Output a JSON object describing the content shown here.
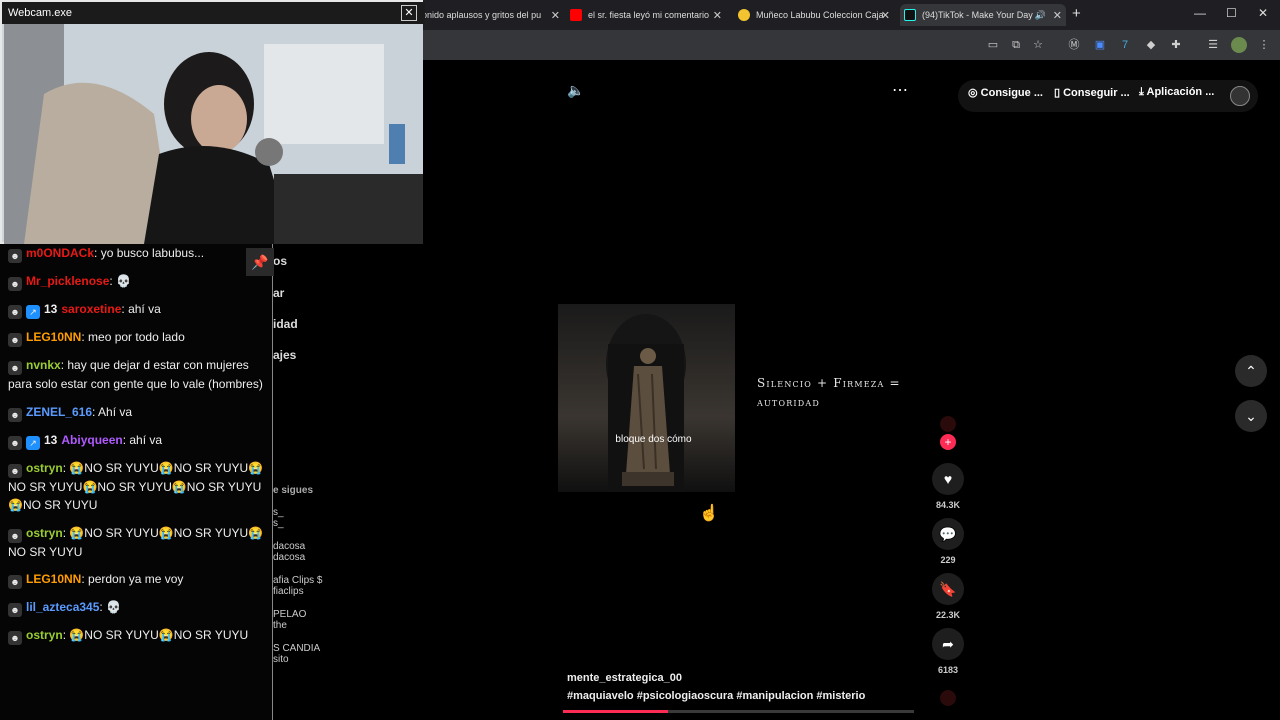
{
  "browser": {
    "tabs": [
      {
        "label": "onido aplausos y gritos del pu",
        "favicon_color": "#ff0000"
      },
      {
        "label": "el sr. fiesta leyó mi comentario",
        "favicon_color": "#ff0000"
      },
      {
        "label": "Muñeco Labubu Coleccion Caja",
        "favicon_color": "#f4c430"
      },
      {
        "label": "(94)TikTok - Make Your Day",
        "favicon_color": "#25f4ee"
      }
    ],
    "new_tab": "+",
    "close": "✕",
    "window_controls": [
      "—",
      "☐",
      "✕"
    ]
  },
  "webcam": {
    "title": "Webcam.exe",
    "close": "✕"
  },
  "chat": {
    "pin_icon": "pin-icon",
    "messages": [
      {
        "user": "m0ONDACk",
        "color": "#e91916",
        "text": "yo busco labubus..."
      },
      {
        "user": "Mr_picklenose",
        "color": "#e91916",
        "text": "💀"
      },
      {
        "badge_num": "13",
        "user": "saroxetine",
        "color": "#e91916",
        "text": "ahí va"
      },
      {
        "user": "LEG10NN",
        "color": "#ff9d00",
        "text": "meo por todo lado"
      },
      {
        "user": "nvnkx",
        "color": "#9acd32",
        "text": "hay que dejar d estar con mujeres para solo estar con gente que lo vale (hombres)"
      },
      {
        "user": "ZENEL_616",
        "color": "#5b9bff",
        "text": "Ahí va"
      },
      {
        "badge_num": "13",
        "user": "Abiyqueen",
        "color": "#b05aff",
        "text": "ahí va"
      },
      {
        "user": "ostryn",
        "color": "#9acd32",
        "text": "😭NO SR YUYU😭NO SR YUYU😭NO SR YUYU😭NO SR YUYU😭NO SR YUYU😭NO SR YUYU"
      },
      {
        "user": "ostryn",
        "color": "#9acd32",
        "text": "😭NO SR YUYU😭NO SR YUYU😭NO SR YUYU"
      },
      {
        "user": "LEG10NN",
        "color": "#ff9d00",
        "text": "perdon ya me voy"
      },
      {
        "user": "lil_azteca345",
        "color": "#5b9bff",
        "text": "💀"
      },
      {
        "user": "ostryn",
        "color": "#9acd32",
        "text": "😭NO SR YUYU😭NO SR YUYU"
      }
    ]
  },
  "tiktok_sidebar": {
    "partial_labels": [
      "os",
      "ar",
      "idad",
      "ajes"
    ],
    "following_header": "e sigues",
    "following": [
      {
        "name": "s_",
        "handle": "s_"
      },
      {
        "name": "dacosa",
        "handle": "dacosa"
      },
      {
        "name": "afia Clips $",
        "handle": "fiaclips"
      },
      {
        "name": "PELAO",
        "handle": "the"
      },
      {
        "name": "S CANDIA",
        "handle": "sito"
      }
    ]
  },
  "tiktok": {
    "top_buttons": [
      "Consigue ...",
      "Conseguir ...",
      "Aplicación ..."
    ],
    "video_caption": "bloque dos cómo",
    "quote_line1": "Silencio + Firmeza =",
    "quote_line2": "autoridad",
    "likes": "84.3K",
    "comments": "229",
    "saves": "22.3K",
    "shares": "6183",
    "author": "mente_estrategica_00",
    "hashtags": "#maquiavelo #psicologiaoscura #manipulacion #misterio",
    "progress_percent": 30
  }
}
